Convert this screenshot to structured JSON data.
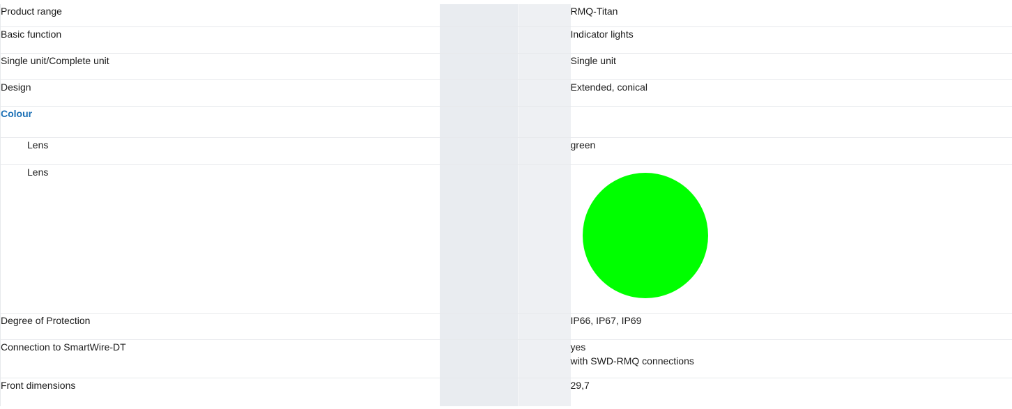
{
  "rows": {
    "product_range": {
      "label": "Product range",
      "value": "RMQ-Titan"
    },
    "basic_function": {
      "label": "Basic function",
      "value": "Indicator lights"
    },
    "unit_type": {
      "label": "Single unit/Complete unit",
      "value": "Single unit"
    },
    "design": {
      "label": "Design",
      "value": "Extended, conical"
    },
    "colour_section": {
      "heading": "Colour"
    },
    "lens_text": {
      "label": "Lens",
      "value": "green"
    },
    "lens_swatch": {
      "label": "Lens",
      "swatch_color": "#00ff00",
      "swatch_icon": "green-circle-swatch"
    },
    "degree_of_protection": {
      "label": "Degree of Protection",
      "value": "IP66, IP67, IP69"
    },
    "smartwire": {
      "label": "Connection to SmartWire-DT",
      "value_line1": "yes",
      "value_line2": "with SWD-RMQ connections"
    },
    "front_dimensions": {
      "label": "Front dimensions",
      "value": "29,7"
    }
  },
  "colors": {
    "heading_blue": "#1a6fb5",
    "mid_column_gray": "#e9ecf0",
    "divider": "#e7e9ec"
  }
}
